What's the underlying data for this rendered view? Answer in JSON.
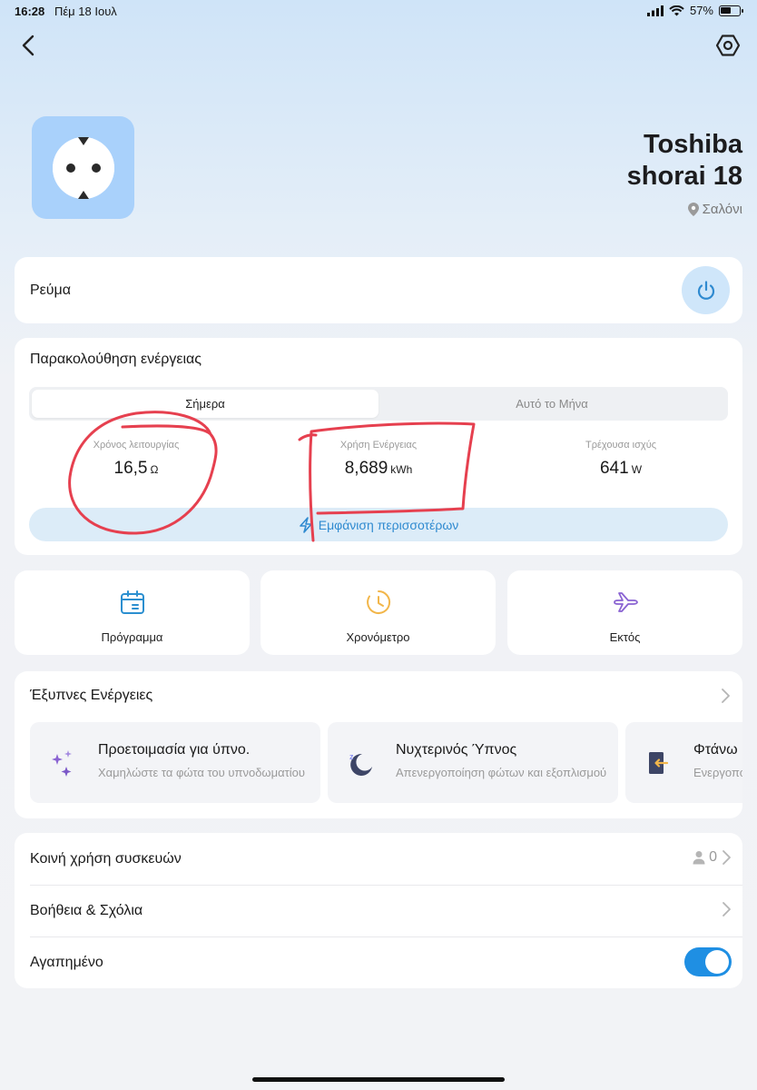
{
  "status_bar": {
    "time": "16:28",
    "date": "Πέμ 18 Ιουλ",
    "battery": "57%",
    "battery_level": 0.57
  },
  "header": {
    "back_icon": "chevron-left-icon",
    "settings_icon": "hexagon-settings-icon"
  },
  "device": {
    "name": "Toshiba shorai 18",
    "location": "Σαλόνι",
    "icon": "power-socket-icon",
    "icon_bg": "#a9d1fb"
  },
  "power": {
    "label": "Ρεύμα",
    "icon": "power-icon"
  },
  "energy": {
    "title": "Παρακολούθηση ενέργειας",
    "tabs": [
      "Σήμερα",
      "Αυτό το Μήνα"
    ],
    "active_tab": "Σήμερα",
    "stats": [
      {
        "label": "Χρόνος λειτουργίας",
        "value": "16,5",
        "unit": "Ω"
      },
      {
        "label": "Χρήση Ενέργειας",
        "value": "8,689",
        "unit": "kWh"
      },
      {
        "label": "Τρέχουσα ισχύς",
        "value": "641",
        "unit": "W"
      }
    ],
    "more_label": "Εμφάνιση περισσοτέρων"
  },
  "shortcuts": [
    {
      "label": "Πρόγραμμα",
      "icon": "calendar-icon",
      "color": "#2b8fd0"
    },
    {
      "label": "Χρονόμετρο",
      "icon": "clock-icon",
      "color": "#f2b64a"
    },
    {
      "label": "Εκτός",
      "icon": "airplane-icon",
      "color": "#8a63d2"
    }
  ],
  "smart_actions": {
    "title": "Έξυπνες Ενέργειες",
    "items": [
      {
        "title": "Προετοιμασία για ύπνο.",
        "subtitle": "Χαμηλώστε τα φώτα του υπνοδωματίου",
        "icon": "sparkles-icon"
      },
      {
        "title": "Νυχτερινός Ύπνος",
        "subtitle": "Απενεργοποίηση φώτων και εξοπλισμού",
        "icon": "moon-icon"
      },
      {
        "title": "Φτάνω",
        "subtitle": "Ενεργοποίηση",
        "icon": "door-arrive-icon"
      }
    ]
  },
  "settings_list": {
    "items": [
      {
        "label": "Κοινή χρήση συσκευών",
        "value": "0",
        "icon": "person-icon"
      },
      {
        "label": "Βοήθεια & Σχόλια"
      },
      {
        "label": "Αγαπημένο",
        "toggle": true
      }
    ]
  },
  "colors": {
    "accent": "#1f8fe3",
    "annotation": "#e63946"
  }
}
